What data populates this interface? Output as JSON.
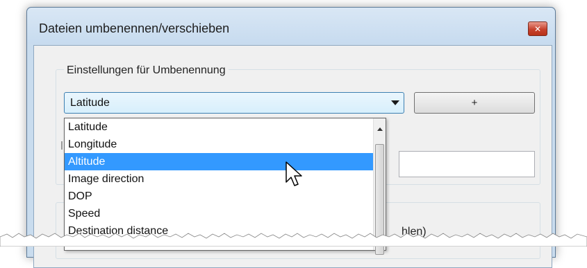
{
  "window": {
    "title": "Dateien umbenennen/verschieben",
    "close_icon": "close-icon"
  },
  "settings_group": {
    "legend": "Einstellungen für Umbenennung"
  },
  "field_select": {
    "value": "Latitude"
  },
  "add_button": {
    "label": "+"
  },
  "dropdown": {
    "items": [
      "Latitude",
      "Longitude",
      "Altitude",
      "Image direction",
      "DOP",
      "Speed",
      "Destination distance"
    ],
    "selected": "Altitude"
  },
  "background_text": {
    "partial_label": "hlen)"
  },
  "colors": {
    "selection": "#3399ff",
    "titlebar": "#c9dcee",
    "client": "#f0f0f0"
  }
}
